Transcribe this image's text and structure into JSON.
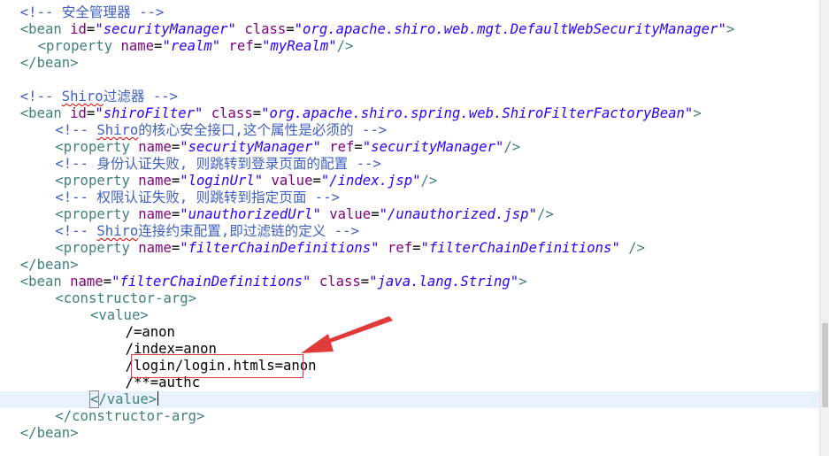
{
  "editor": {
    "lines": [
      {
        "indent": 1,
        "parts": [
          {
            "t": "<!-- 安全管理器 -->",
            "c": "c-comment"
          }
        ]
      },
      {
        "indent": 1,
        "parts": [
          {
            "t": "<bean ",
            "c": "c-tag"
          },
          {
            "t": "id",
            "c": "c-attr"
          },
          {
            "t": "=",
            "c": "c-eq"
          },
          {
            "t": "\"securityManager\"",
            "c": "c-val"
          },
          {
            "t": " ",
            "c": "c-text"
          },
          {
            "t": "class",
            "c": "c-attr"
          },
          {
            "t": "=",
            "c": "c-eq"
          },
          {
            "t": "\"org.apache.shiro.web.mgt.DefaultWebSecurityManager\"",
            "c": "c-val"
          },
          {
            "t": ">",
            "c": "c-tag"
          }
        ]
      },
      {
        "indent": 2,
        "parts": [
          {
            "t": "<property ",
            "c": "c-tag"
          },
          {
            "t": "name",
            "c": "c-attr"
          },
          {
            "t": "=",
            "c": "c-eq"
          },
          {
            "t": "\"realm\"",
            "c": "c-val"
          },
          {
            "t": " ",
            "c": "c-text"
          },
          {
            "t": "ref",
            "c": "c-attr"
          },
          {
            "t": "=",
            "c": "c-eq"
          },
          {
            "t": "\"myRealm\"",
            "c": "c-val"
          },
          {
            "t": "/>",
            "c": "c-tag"
          }
        ]
      },
      {
        "indent": 1,
        "parts": [
          {
            "t": "</bean>",
            "c": "c-tag"
          }
        ]
      },
      {
        "indent": 0,
        "parts": []
      },
      {
        "indent": 1,
        "parts": [
          {
            "t": "<!-- ",
            "c": "c-comment"
          },
          {
            "t": "Shiro",
            "c": "c-comment squiggle"
          },
          {
            "t": "过滤器 -->",
            "c": "c-comment"
          }
        ]
      },
      {
        "indent": 1,
        "parts": [
          {
            "t": "<bean ",
            "c": "c-tag"
          },
          {
            "t": "id",
            "c": "c-attr"
          },
          {
            "t": "=",
            "c": "c-eq"
          },
          {
            "t": "\"shiroFilter\"",
            "c": "c-val"
          },
          {
            "t": " ",
            "c": "c-text"
          },
          {
            "t": "class",
            "c": "c-attr"
          },
          {
            "t": "=",
            "c": "c-eq"
          },
          {
            "t": "\"org.apache.shiro.spring.web.ShiroFilterFactoryBean\"",
            "c": "c-val"
          },
          {
            "t": ">",
            "c": "c-tag"
          }
        ]
      },
      {
        "indent": 3,
        "parts": [
          {
            "t": "<!-- ",
            "c": "c-comment"
          },
          {
            "t": "Shiro",
            "c": "c-comment squiggle"
          },
          {
            "t": "的核心安全接口,这个属性是必须的 -->",
            "c": "c-comment"
          }
        ]
      },
      {
        "indent": 3,
        "parts": [
          {
            "t": "<property ",
            "c": "c-tag"
          },
          {
            "t": "name",
            "c": "c-attr"
          },
          {
            "t": "=",
            "c": "c-eq"
          },
          {
            "t": "\"securityManager\"",
            "c": "c-val"
          },
          {
            "t": " ",
            "c": "c-text"
          },
          {
            "t": "ref",
            "c": "c-attr"
          },
          {
            "t": "=",
            "c": "c-eq"
          },
          {
            "t": "\"securityManager\"",
            "c": "c-val"
          },
          {
            "t": "/>",
            "c": "c-tag"
          }
        ]
      },
      {
        "indent": 3,
        "parts": [
          {
            "t": "<!-- 身份认证失败, 则跳转到登录页面的配置 -->",
            "c": "c-comment"
          }
        ]
      },
      {
        "indent": 3,
        "parts": [
          {
            "t": "<property ",
            "c": "c-tag"
          },
          {
            "t": "name",
            "c": "c-attr"
          },
          {
            "t": "=",
            "c": "c-eq"
          },
          {
            "t": "\"loginUrl\"",
            "c": "c-val"
          },
          {
            "t": " ",
            "c": "c-text"
          },
          {
            "t": "value",
            "c": "c-attr"
          },
          {
            "t": "=",
            "c": "c-eq"
          },
          {
            "t": "\"/index.jsp\"",
            "c": "c-val"
          },
          {
            "t": "/>",
            "c": "c-tag"
          }
        ]
      },
      {
        "indent": 3,
        "parts": [
          {
            "t": "<!-- 权限认证失败, 则跳转到指定页面 -->",
            "c": "c-comment"
          }
        ]
      },
      {
        "indent": 3,
        "parts": [
          {
            "t": "<property ",
            "c": "c-tag"
          },
          {
            "t": "name",
            "c": "c-attr"
          },
          {
            "t": "=",
            "c": "c-eq"
          },
          {
            "t": "\"unauthorizedUrl\"",
            "c": "c-val"
          },
          {
            "t": " ",
            "c": "c-text"
          },
          {
            "t": "value",
            "c": "c-attr"
          },
          {
            "t": "=",
            "c": "c-eq"
          },
          {
            "t": "\"/unauthorized.jsp\"",
            "c": "c-val"
          },
          {
            "t": "/>",
            "c": "c-tag"
          }
        ]
      },
      {
        "indent": 3,
        "parts": [
          {
            "t": "<!-- ",
            "c": "c-comment"
          },
          {
            "t": "Shiro",
            "c": "c-comment squiggle"
          },
          {
            "t": "连接约束配置,即过滤链的定义 -->",
            "c": "c-comment"
          }
        ]
      },
      {
        "indent": 3,
        "parts": [
          {
            "t": "<property ",
            "c": "c-tag"
          },
          {
            "t": "name",
            "c": "c-attr"
          },
          {
            "t": "=",
            "c": "c-eq"
          },
          {
            "t": "\"filterChainDefinitions\"",
            "c": "c-val"
          },
          {
            "t": " ",
            "c": "c-text"
          },
          {
            "t": "ref",
            "c": "c-attr"
          },
          {
            "t": "=",
            "c": "c-eq"
          },
          {
            "t": "\"filterChainDefinitions\"",
            "c": "c-val"
          },
          {
            "t": " />",
            "c": "c-tag"
          }
        ]
      },
      {
        "indent": 1,
        "parts": [
          {
            "t": "</bean>",
            "c": "c-tag"
          }
        ]
      },
      {
        "indent": 1,
        "parts": [
          {
            "t": "<bean ",
            "c": "c-tag"
          },
          {
            "t": "name",
            "c": "c-attr"
          },
          {
            "t": "=",
            "c": "c-eq"
          },
          {
            "t": "\"filterChainDefinitions\"",
            "c": "c-val"
          },
          {
            "t": " ",
            "c": "c-text"
          },
          {
            "t": "class",
            "c": "c-attr"
          },
          {
            "t": "=",
            "c": "c-eq"
          },
          {
            "t": "\"java.lang.String\"",
            "c": "c-val"
          },
          {
            "t": ">",
            "c": "c-tag"
          }
        ]
      },
      {
        "indent": 3,
        "parts": [
          {
            "t": "<constructor-arg>",
            "c": "c-tag"
          }
        ]
      },
      {
        "indent": 5,
        "parts": [
          {
            "t": "<value>",
            "c": "c-tag"
          }
        ]
      },
      {
        "indent": 7,
        "parts": [
          {
            "t": "/=anon",
            "c": "c-text"
          }
        ]
      },
      {
        "indent": 7,
        "parts": [
          {
            "t": "/index=anon",
            "c": "c-text"
          }
        ]
      },
      {
        "indent": 7,
        "parts": [
          {
            "t": "/login/login.htmls=anon",
            "c": "c-text"
          }
        ]
      },
      {
        "indent": 7,
        "parts": [
          {
            "t": "/**=authc",
            "c": "c-text"
          }
        ]
      },
      {
        "indent": 5,
        "current": true,
        "parts": [
          {
            "t": "<",
            "c": "c-tag bracket-match"
          },
          {
            "t": "/value>",
            "c": "c-tag"
          }
        ]
      },
      {
        "indent": 3,
        "parts": [
          {
            "t": "</constructor-arg>",
            "c": "c-tag"
          }
        ]
      },
      {
        "indent": 1,
        "parts": [
          {
            "t": "</bean>",
            "c": "c-tag"
          }
        ]
      }
    ]
  },
  "annotation": {
    "box_color": "#e03a3a",
    "arrow_color": "#e03a3a"
  },
  "colors": {
    "comment": "#3f5fbf",
    "tag": "#3f7f7f",
    "attribute": "#7f007f",
    "value": "#2a00ff",
    "current_line": "#e8f2fe"
  }
}
